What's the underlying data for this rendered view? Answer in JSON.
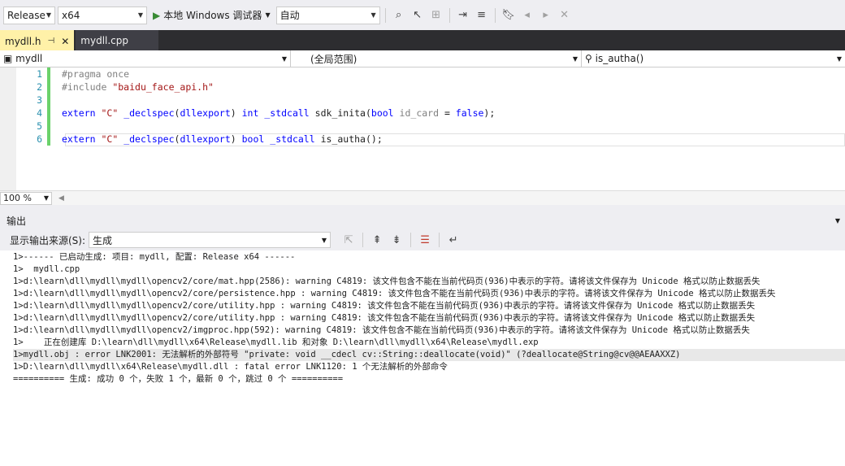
{
  "toolbar": {
    "config": "Release",
    "platform": "x64",
    "run_label": "本地 Windows 调试器",
    "mode": "自动"
  },
  "tabs": [
    {
      "label": "mydll.h",
      "pin": "ᵖ",
      "close": "✕"
    },
    {
      "label": "mydll.cpp"
    }
  ],
  "navbar": {
    "project": "mydll",
    "scope": "(全局范围)",
    "member": "is_autha()"
  },
  "editor": {
    "line_numbers": [
      "1",
      "2",
      "3",
      "4",
      "5",
      "6"
    ],
    "lines": [
      "#pragma once",
      "#include \"baidu_face_api.h\"",
      "",
      "extern \"C\" _declspec(dllexport) int _stdcall sdk_inita(bool id_card = false);",
      "",
      "extern \"C\" _declspec(dllexport) bool _stdcall is_autha();"
    ],
    "zoom": "100 %"
  },
  "output": {
    "title": "输出",
    "source_label": "显示输出来源(S):",
    "source_value": "生成",
    "lines": [
      "1>------ 已启动生成: 项目: mydll, 配置: Release x64 ------",
      "1>  mydll.cpp",
      "1>d:\\learn\\dll\\mydll\\mydll\\opencv2/core/mat.hpp(2586): warning C4819: 该文件包含不能在当前代码页(936)中表示的字符。请将该文件保存为 Unicode 格式以防止数据丢失",
      "1>d:\\learn\\dll\\mydll\\mydll\\opencv2/core/persistence.hpp : warning C4819: 该文件包含不能在当前代码页(936)中表示的字符。请将该文件保存为 Unicode 格式以防止数据丢失",
      "1>d:\\learn\\dll\\mydll\\mydll\\opencv2/core/utility.hpp : warning C4819: 该文件包含不能在当前代码页(936)中表示的字符。请将该文件保存为 Unicode 格式以防止数据丢失",
      "1>d:\\learn\\dll\\mydll\\mydll\\opencv2/core/utility.hpp : warning C4819: 该文件包含不能在当前代码页(936)中表示的字符。请将该文件保存为 Unicode 格式以防止数据丢失",
      "1>d:\\learn\\dll\\mydll\\mydll\\opencv2/imgproc.hpp(592): warning C4819: 该文件包含不能在当前代码页(936)中表示的字符。请将该文件保存为 Unicode 格式以防止数据丢失",
      "1>    正在创建库 D:\\learn\\dll\\mydll\\x64\\Release\\mydll.lib 和对象 D:\\learn\\dll\\mydll\\x64\\Release\\mydll.exp",
      "1>mydll.obj : error LNK2001: 无法解析的外部符号 \"private: void __cdecl cv::String::deallocate(void)\" (?deallocate@String@cv@@AEAAXXZ)",
      "1>D:\\learn\\dll\\mydll\\x64\\Release\\mydll.dll : fatal error LNK1120: 1 个无法解析的外部命令",
      "========== 生成: 成功 0 个，失败 1 个，最新 0 个，跳过 0 个 =========="
    ]
  },
  "colors": {
    "accent_tab": "#fff1a8",
    "dark_chrome": "#2d2d30",
    "change_bar": "#6bd26b"
  }
}
